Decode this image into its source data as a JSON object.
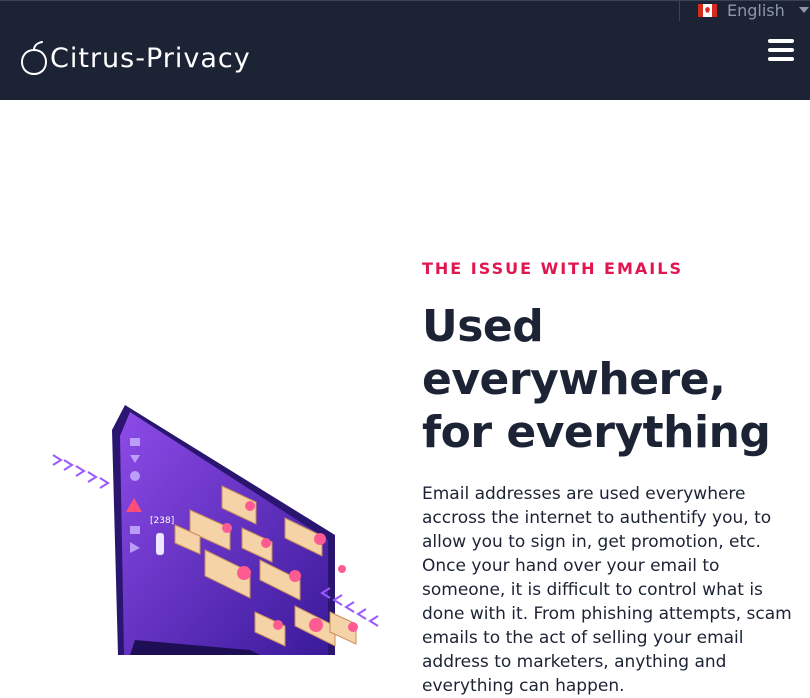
{
  "header": {
    "brand": "Citrus-Privacy",
    "language": {
      "flag_icon": "canada-flag-icon",
      "label": "English"
    },
    "menu_icon": "hamburger-menu-icon"
  },
  "section": {
    "eyebrow": "THE ISSUE WITH EMAILS",
    "heading": "Used everywhere, for everything",
    "body": "Email addresses are used everywhere accross the internet to authentify you, to allow you to sign in, get promotion, etc. Once your hand over your email to someone, it is difficult to control what is done with it. From phishing attempts, scam emails to the act of selling your email address to marketers, anything and everything can happen.",
    "illustration": "email-overload-monitor-illustration"
  },
  "colors": {
    "navbar": "#1c2335",
    "accent": "#e0174f",
    "text": "#1c2335",
    "illustration_purple": "#6b2fd6"
  }
}
